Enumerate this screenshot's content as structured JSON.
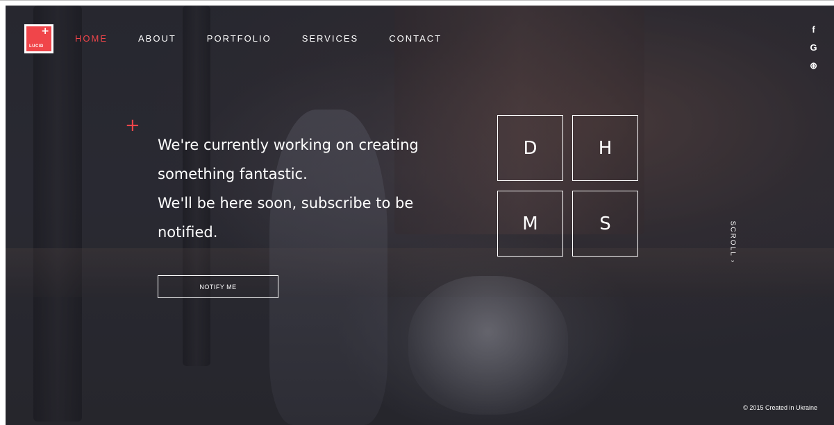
{
  "brand": {
    "logo_text": "LUCID",
    "logo_plus": "+",
    "accent_color": "#f0454a"
  },
  "nav": {
    "items": [
      {
        "label": "HOME",
        "active": true
      },
      {
        "label": "ABOUT",
        "active": false
      },
      {
        "label": "PORTFOLIO",
        "active": false
      },
      {
        "label": "SERVICES",
        "active": false
      },
      {
        "label": "CONTACT",
        "active": false
      }
    ]
  },
  "social": {
    "facebook": "f",
    "google": "G",
    "dribbble": "⊛"
  },
  "hero": {
    "plus": "+",
    "line1": "We're currently working on creating",
    "line2": "something fantastic.",
    "line3": "We'll be here soon, subscribe to be",
    "line4": "notified.",
    "button_label": "NOTIFY ME"
  },
  "countdown": {
    "days": "D",
    "hours": "H",
    "minutes": "M",
    "seconds": "S"
  },
  "scroll": {
    "label": "SCROLL ›"
  },
  "footer": {
    "copyright": "© 2015 Created in Ukraine"
  }
}
